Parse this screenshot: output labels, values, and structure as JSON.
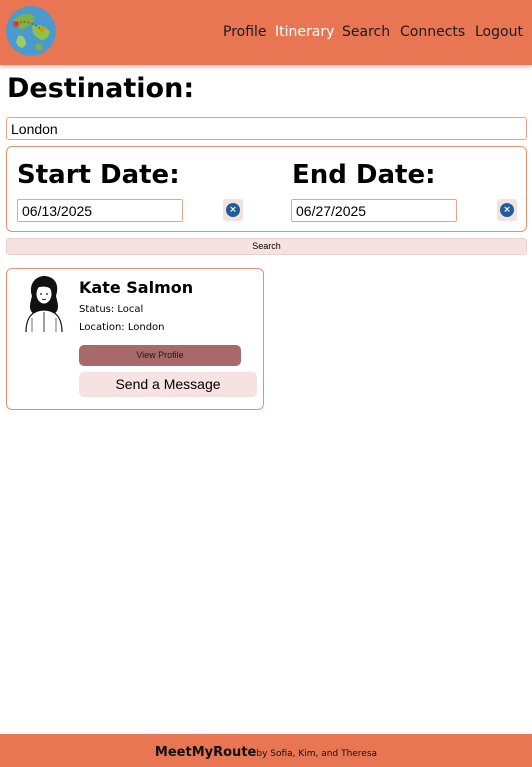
{
  "nav": {
    "items": [
      "Profile",
      "Itinerary",
      "Search",
      "Connects",
      "Logout"
    ],
    "active": "Itinerary"
  },
  "search": {
    "destination_label": "Destination:",
    "destination_value": "London",
    "start_label": "Start Date:",
    "start_value": "06/13/2025",
    "end_label": "End Date:",
    "end_value": "06/27/2025",
    "search_button": "Search"
  },
  "results": [
    {
      "name": "Kate Salmon",
      "status": "Status: Local",
      "location": "Location: London",
      "view_profile": "View Profile",
      "send_message": "Send a Message"
    }
  ],
  "footer": {
    "brand": "MeetMyRoute",
    "credits": "by Sofia, Kim, and Theresa"
  },
  "colors": {
    "header": "#e97653",
    "accent_border": "#e98f70",
    "view_button": "#a8696a",
    "light_button": "#f6e2e0",
    "clear_icon": "#1f5e9e"
  },
  "icons": {
    "logo": "globe-logo-icon",
    "clear": "clear-icon",
    "avatar": "woman-avatar-icon"
  }
}
